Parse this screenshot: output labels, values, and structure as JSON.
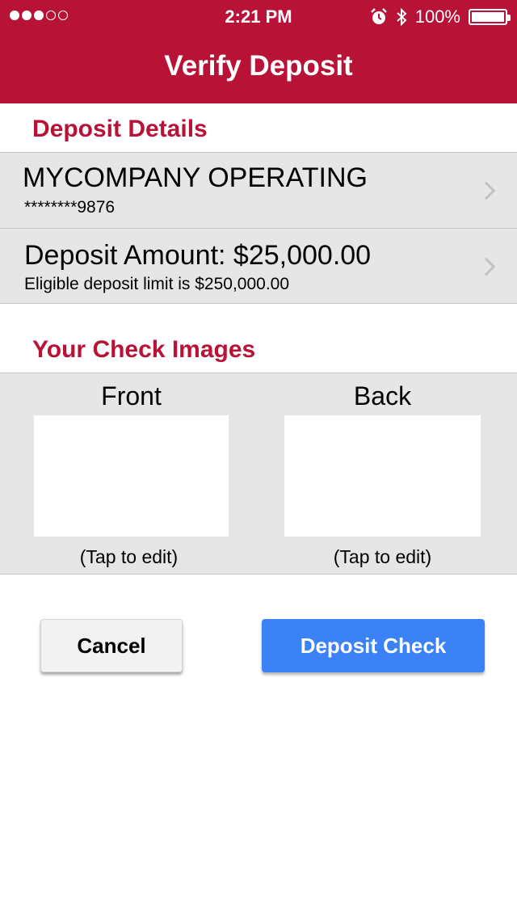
{
  "status_bar": {
    "time": "2:21 PM",
    "battery_percent": "100%",
    "signal_bars_filled": 3,
    "signal_bars_total": 5
  },
  "nav": {
    "title": "Verify Deposit"
  },
  "deposit_details": {
    "section_title": "Deposit Details",
    "account": {
      "name": "MYCOMPANY OPERATING",
      "number": "********9876"
    },
    "amount": {
      "label": "Deposit Amount: $25,000.00",
      "limit": "Eligible deposit limit is $250,000.00"
    }
  },
  "check_images": {
    "section_title": "Your Check Images",
    "front": {
      "label": "Front",
      "hint": "(Tap to edit)"
    },
    "back": {
      "label": "Back",
      "hint": "(Tap to edit)"
    }
  },
  "actions": {
    "cancel_label": "Cancel",
    "deposit_label": "Deposit Check"
  },
  "colors": {
    "brand": "#b81237",
    "primary_button": "#3a82f5",
    "row_background": "#e6e6e6"
  }
}
